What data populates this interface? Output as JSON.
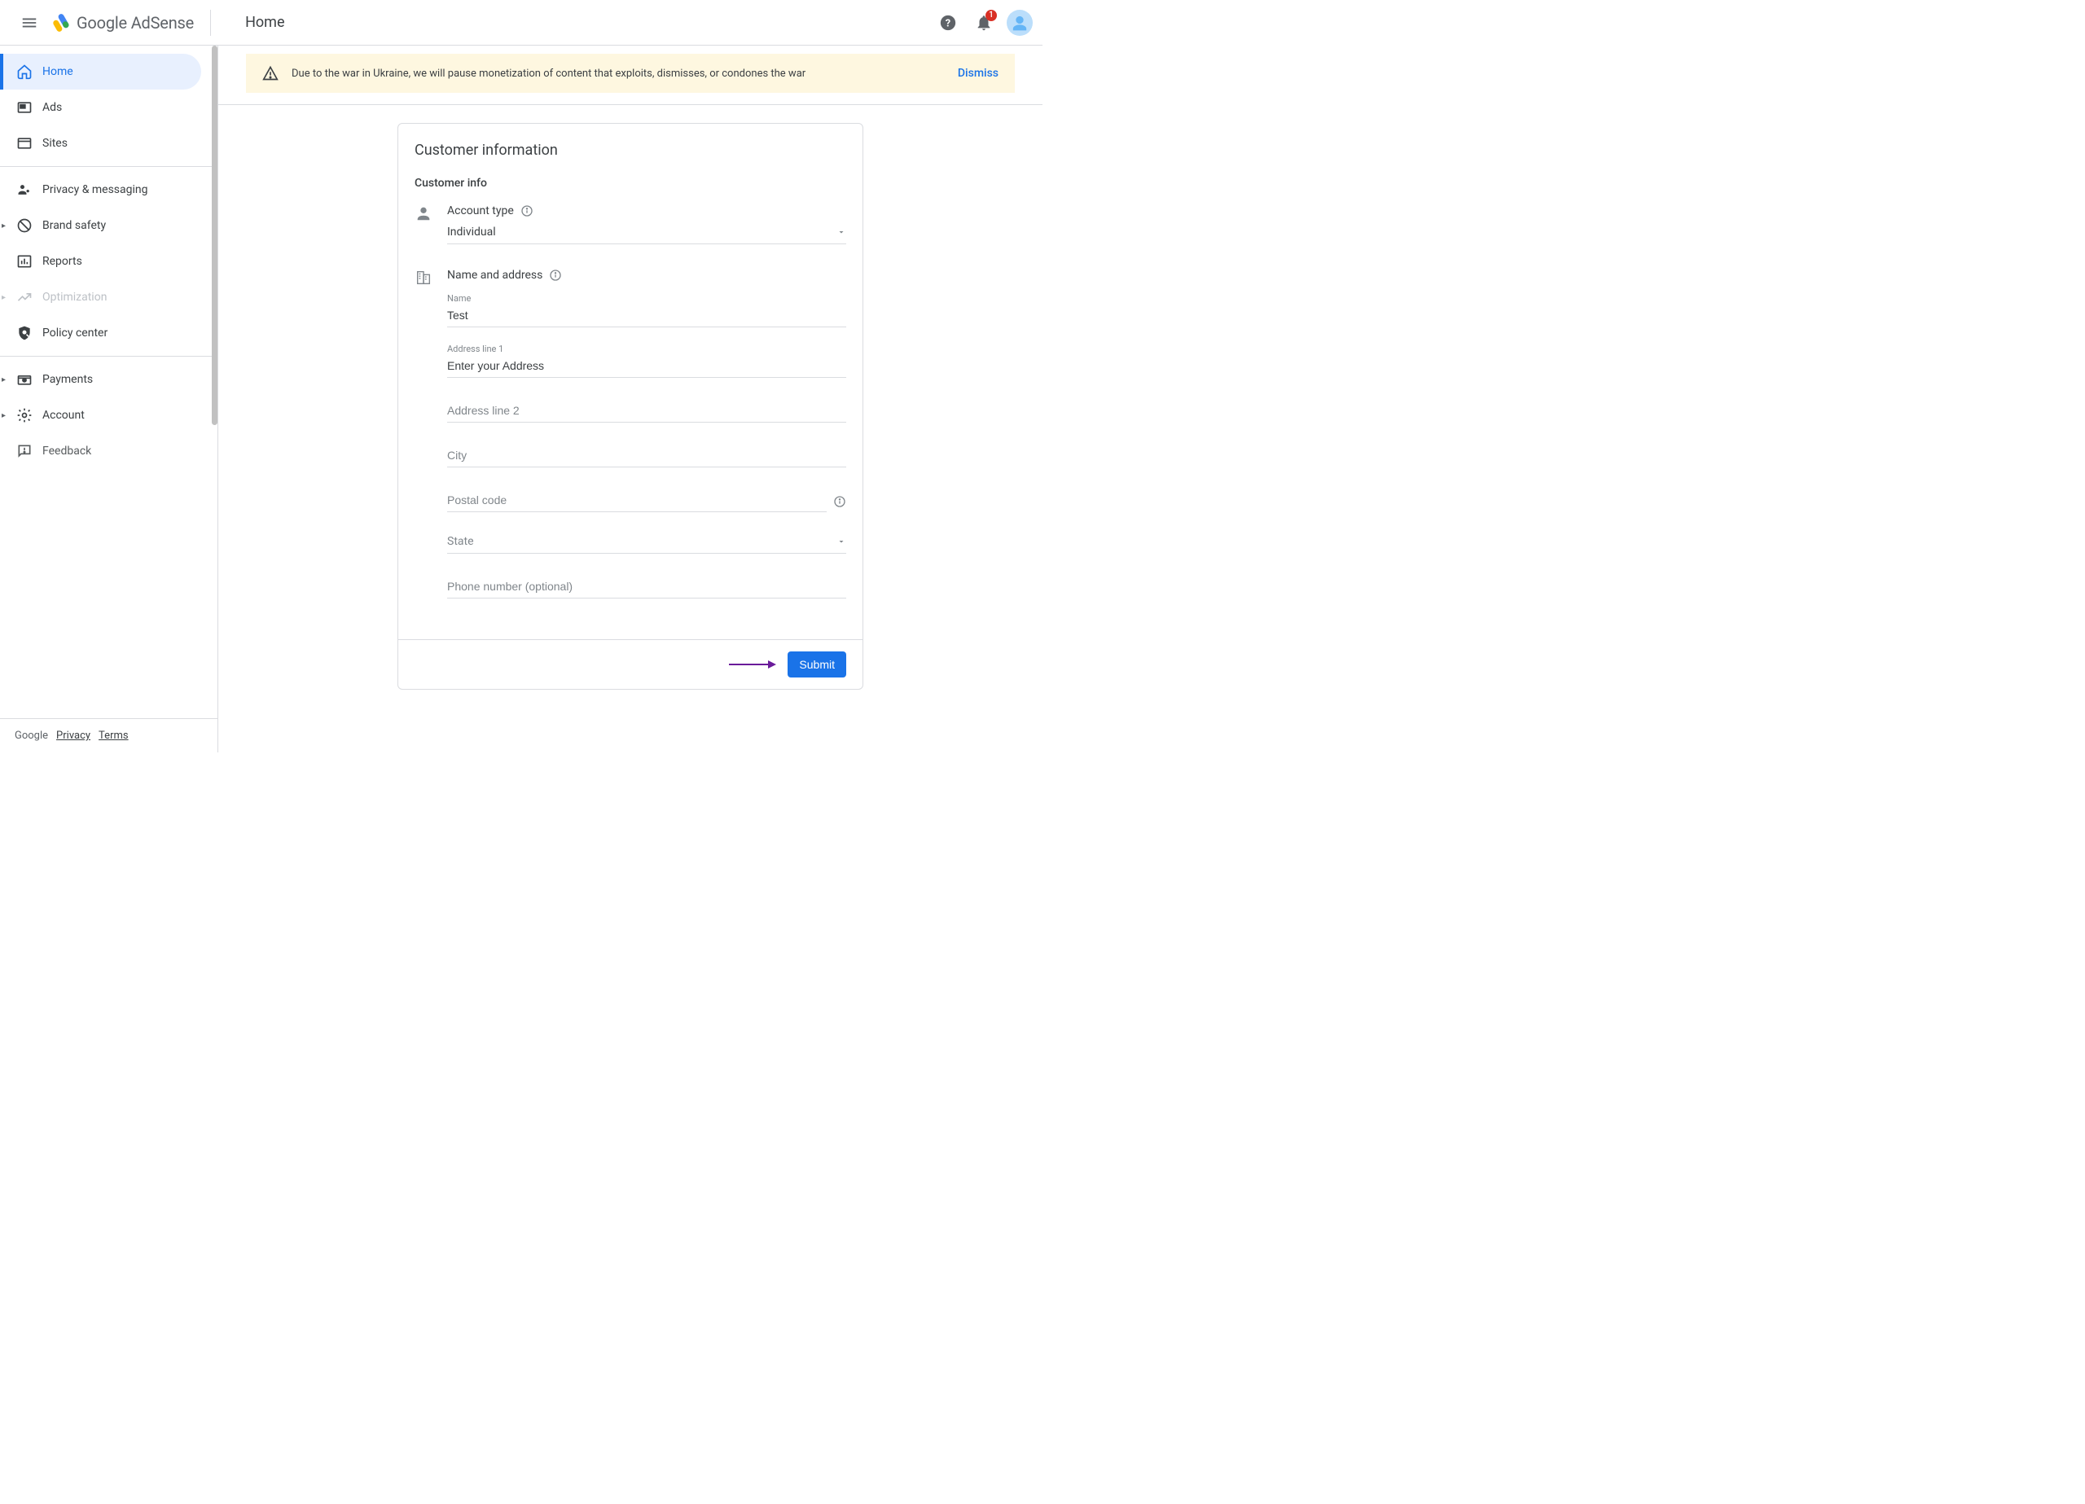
{
  "header": {
    "logo_text": "Google AdSense",
    "page_title": "Home",
    "notification_count": "1"
  },
  "sidebar": {
    "items": [
      {
        "label": "Home"
      },
      {
        "label": "Ads"
      },
      {
        "label": "Sites"
      },
      {
        "label": "Privacy & messaging"
      },
      {
        "label": "Brand safety"
      },
      {
        "label": "Reports"
      },
      {
        "label": "Optimization"
      },
      {
        "label": "Policy center"
      },
      {
        "label": "Payments"
      },
      {
        "label": "Account"
      },
      {
        "label": "Feedback"
      }
    ],
    "footer": {
      "google": "Google",
      "privacy": "Privacy",
      "terms": "Terms"
    }
  },
  "banner": {
    "text": "Due to the war in Ukraine, we will pause monetization of content that exploits, dismisses, or condones the war",
    "dismiss": "Dismiss"
  },
  "card": {
    "title": "Customer information",
    "subtitle": "Customer info",
    "account_type_label": "Account type",
    "account_type_value": "Individual",
    "name_address_label": "Name and address",
    "name_label": "Name",
    "name_value": "Test",
    "addr1_label": "Address line 1",
    "addr1_value": "Enter your Address",
    "addr2_ph": "Address line 2",
    "city_ph": "City",
    "postal_ph": "Postal code",
    "state_ph": "State",
    "phone_ph": "Phone number (optional)",
    "submit": "Submit"
  }
}
